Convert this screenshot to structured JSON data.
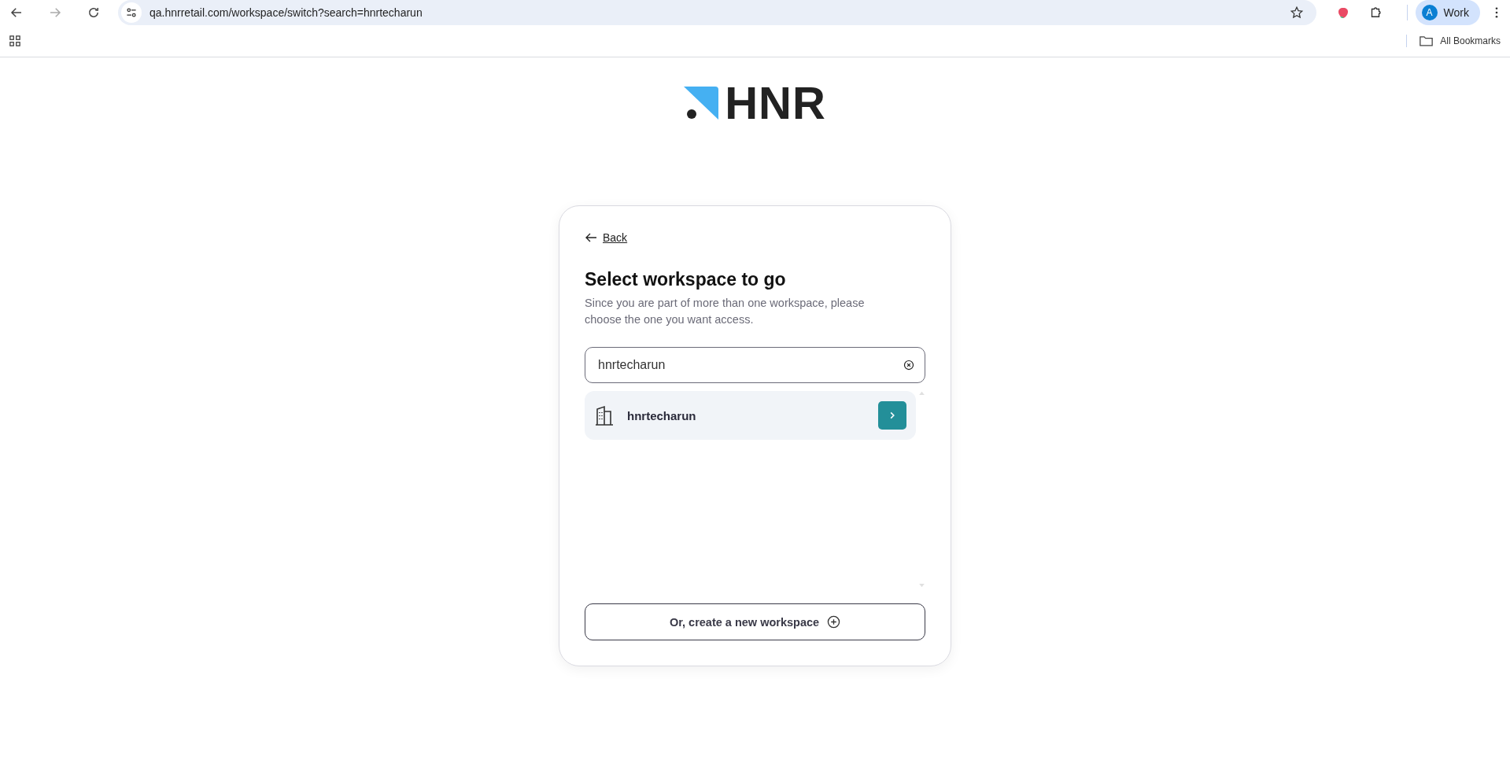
{
  "browser": {
    "url": "qa.hnrretail.com/workspace/switch?search=hnrtecharun",
    "profile": {
      "initial": "A",
      "label": "Work"
    },
    "bookmarks_folder": "All Bookmarks"
  },
  "logo": {
    "text": "HNR"
  },
  "card": {
    "back": "Back",
    "title": "Select workspace to go",
    "subtitle": "Since you are part of more than one workspace, please choose the one you want access.",
    "search": {
      "value": "hnrtecharun"
    },
    "workspaces": [
      {
        "name": "hnrtecharun"
      }
    ],
    "create_button": "Or, create a new workspace"
  }
}
